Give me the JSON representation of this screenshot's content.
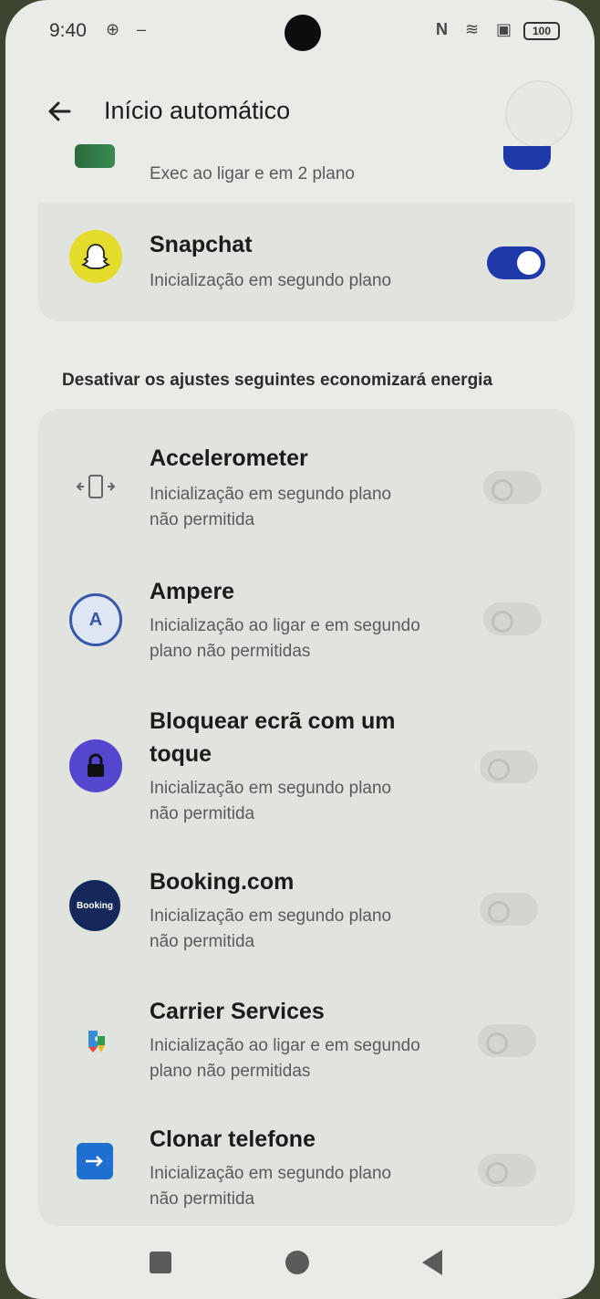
{
  "status_bar": {
    "time": "9:40",
    "battery": "100"
  },
  "header": {
    "title": "Início automático"
  },
  "partial_item": {
    "description": "Exec ao ligar e em 2 plano"
  },
  "enabled_apps": [
    {
      "name": "Snapchat",
      "description": "Inicialização em segundo plano",
      "enabled": true
    }
  ],
  "section_label": "Desativar os ajustes seguintes economizará energia",
  "disabled_apps": [
    {
      "name": "Accelerometer",
      "description": "Inicialização em segundo plano\nnão permitida",
      "enabled": false
    },
    {
      "name": "Ampere",
      "description": "Inicialização ao ligar e em segundo\nplano não permitidas",
      "enabled": false
    },
    {
      "name": "Bloquear ecrã com um\ntoque",
      "description": "Inicialização em segundo plano\nnão permitida",
      "enabled": false
    },
    {
      "name": "Booking.com",
      "description": "Inicialização em segundo plano\nnão permitida",
      "enabled": false
    },
    {
      "name": "Carrier Services",
      "description": "Inicialização ao ligar e em segundo\nplano não permitidas",
      "enabled": false
    },
    {
      "name": "Clonar telefone",
      "description": "Inicialização em segundo plano\nnão permitida",
      "enabled": false
    }
  ],
  "icons": {
    "booking_logo_text": "Booking",
    "ampere_letter": "A"
  },
  "colors": {
    "accent": "#1f3aa8",
    "background": "#e9ebe6"
  }
}
